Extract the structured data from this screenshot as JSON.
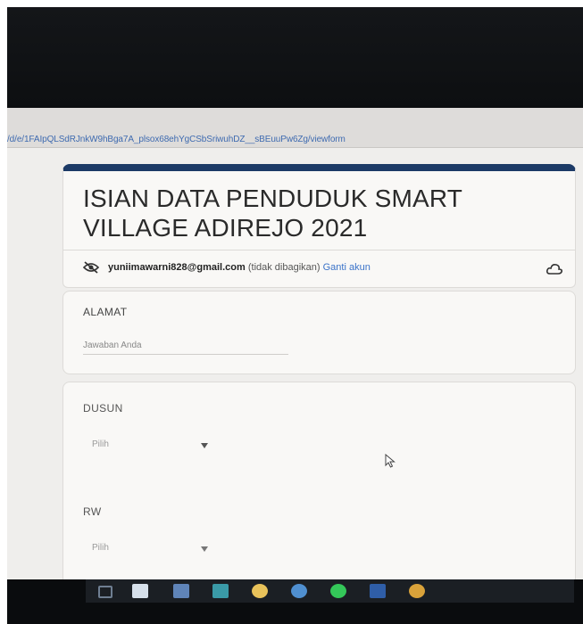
{
  "browser": {
    "url": "/d/e/1FAIpQLSdRJnkW9hBga7A_plsox68ehYgCSbSriwuhDZ__sBEuuPw6Zg/viewform"
  },
  "form": {
    "title": "ISIAN DATA PENDUDUK SMART VILLAGE ADIREJO 2021",
    "account": {
      "email": "yuniimawarni828@gmail.com",
      "note": "(tidak dibagikan)",
      "switch_label": "Ganti akun"
    },
    "questions": [
      {
        "label": "ALAMAT",
        "placeholder": "Jawaban Anda"
      },
      {
        "label": "DUSUN",
        "selected": "Pilih"
      },
      {
        "label": "RW",
        "selected": "Pilih"
      }
    ]
  },
  "colors": {
    "header_accent": "#1c3a66",
    "link": "#3b73c9"
  },
  "icons": {
    "account": "eye-off-icon",
    "cloud": "cloud-icon",
    "dropdown": "chevron-down-icon",
    "taskbar": [
      "task-view-icon",
      "store-icon",
      "mail-icon",
      "folder-icon",
      "paint-icon",
      "media-icon",
      "spotify-icon",
      "word-icon",
      "chrome-icon"
    ]
  }
}
